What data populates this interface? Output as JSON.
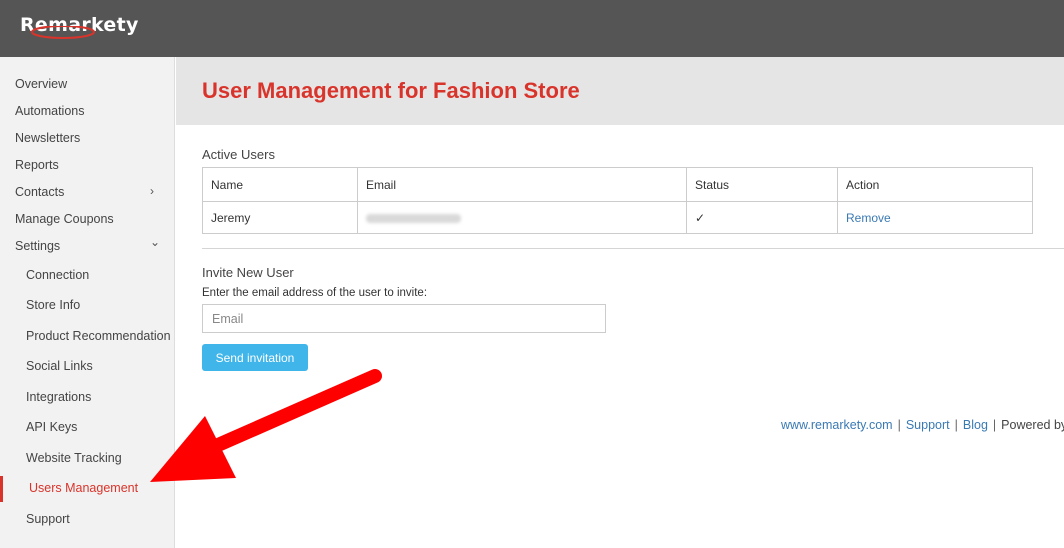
{
  "header": {
    "logo_text": "Remarkety"
  },
  "sidebar": {
    "items": [
      {
        "label": "Overview"
      },
      {
        "label": "Automations"
      },
      {
        "label": "Newsletters"
      },
      {
        "label": "Reports"
      },
      {
        "label": "Contacts",
        "chevron": "›"
      },
      {
        "label": "Manage Coupons"
      },
      {
        "label": "Settings",
        "chevron": "⌄"
      }
    ],
    "settings_items": [
      {
        "label": "Connection"
      },
      {
        "label": "Store Info"
      },
      {
        "label": "Product Recommendation"
      },
      {
        "label": "Social Links"
      },
      {
        "label": "Integrations"
      },
      {
        "label": "API Keys"
      },
      {
        "label": "Website Tracking"
      },
      {
        "label": "Users Management",
        "active": true
      },
      {
        "label": "Support"
      }
    ]
  },
  "main": {
    "title": "User Management for Fashion Store",
    "active_users": {
      "label": "Active Users",
      "columns": [
        "Name",
        "Email",
        "Status",
        "Action"
      ],
      "rows": [
        {
          "name": "Jeremy",
          "email": "",
          "status": "✓",
          "action": "Remove"
        }
      ]
    },
    "invite": {
      "label": "Invite New User",
      "helper": "Enter the email address of the user to invite:",
      "email_placeholder": "Email",
      "button": "Send invitation"
    },
    "footer": {
      "links": [
        "www.remarkety.com",
        "Support",
        "Blog"
      ],
      "trailing": "Powered by"
    }
  },
  "colors": {
    "accent_red": "#d9342b",
    "topbar": "#555555",
    "button_blue": "#3fb5ea",
    "link_blue": "#3a7ab3"
  }
}
